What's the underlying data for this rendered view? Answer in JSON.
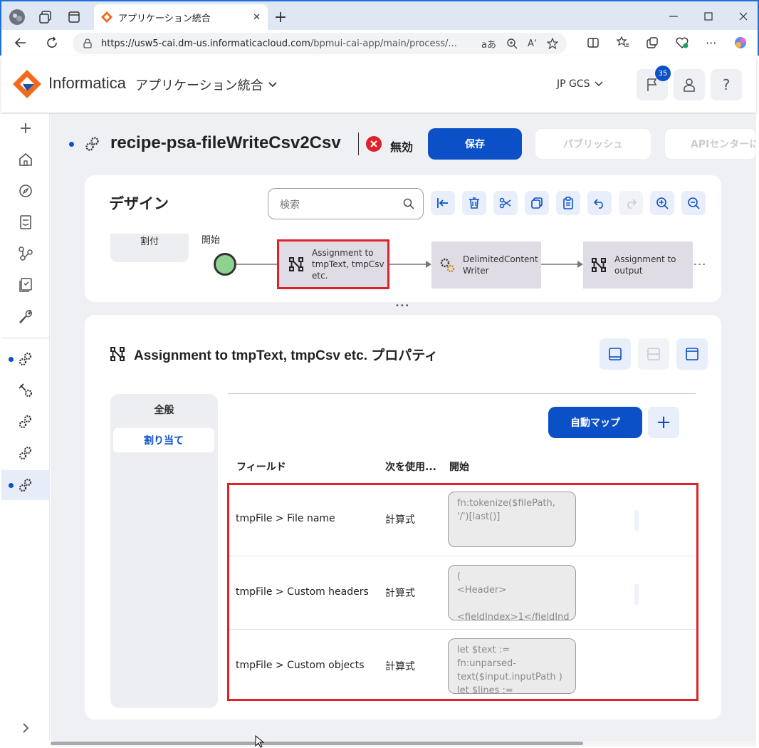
{
  "browser": {
    "tab_title": "アプリケーション統合",
    "url_host": "https://usw5-cai.dm-us.informaticacloud.com",
    "url_path": "/bpmui-cai-app/main/process/...",
    "close_tab": "✕",
    "new_tab": "+"
  },
  "app": {
    "brand": "Informatica",
    "product": "アプリケーション統合",
    "org": "JP GCS",
    "notification_count": "35",
    "help": "?"
  },
  "process": {
    "title": "recipe-psa-fileWriteCsv2Csv",
    "status": "無効",
    "save_label": "保存",
    "publish_label": "パブリッシュ",
    "api_center_label": "APIセンターに"
  },
  "design": {
    "title": "デザイン",
    "search_placeholder": "検索",
    "assign_label": "割付",
    "start_label": "開始",
    "nodes": [
      {
        "label": "Assignment to tmpText, tmpCsv etc."
      },
      {
        "label": "DelimitedContent Writer"
      },
      {
        "label": "Assignment to output"
      }
    ],
    "more": "•••"
  },
  "properties": {
    "title": "Assignment to tmpText, tmpCsv etc. プロパティ",
    "tabs": [
      {
        "label": "全般"
      },
      {
        "label": "割り当て"
      }
    ],
    "auto_map_label": "自動マップ",
    "add_label": "+",
    "columns": {
      "field": "フィールド",
      "use": "次を使用...",
      "start": "開始"
    },
    "rows": [
      {
        "field": "tmpFile > File name",
        "use": "計算式",
        "value": "fn:tokenize($filePath,\n'/')[last()]"
      },
      {
        "field": "tmpFile > Custom headers",
        "use": "計算式",
        "value": "(\n<Header>\n\n<fieldIndex>1</fieldInd"
      },
      {
        "field": "tmpFile > Custom objects",
        "use": "計算式",
        "value": "let $text :=\nfn:unparsed-\ntext($input.inputPath )\nlet $lines :="
      }
    ]
  },
  "colors": {
    "primary": "#0b50c6",
    "highlight": "#e0202a",
    "start_node": "#8fd18f",
    "node_bg": "#e0dce6"
  }
}
